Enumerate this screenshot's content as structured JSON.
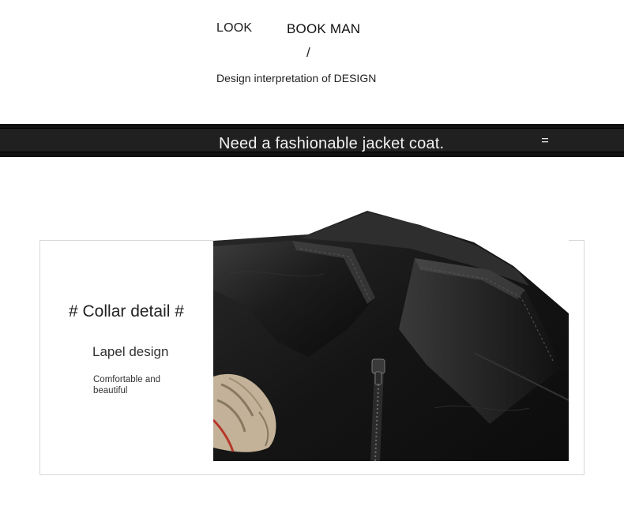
{
  "header": {
    "look_label": "LOOK",
    "brand_name": "BOOK MAN",
    "divider": "/",
    "subtitle": "Design interpretation of DESIGN"
  },
  "banner": {
    "text": "Need a fashionable jacket coat.",
    "icon": "menu-icon"
  },
  "detail_card": {
    "title": "# Collar detail #",
    "subtitle": "Lapel design",
    "description": "Comfortable and beautiful"
  },
  "product_image": {
    "subject": "black leather jacket collar with zipper and embroidered patch",
    "colors": {
      "leather": "#141414",
      "highlight": "#4a4a4a",
      "patch": "#cdbba0",
      "patch_accent": "#c0392b"
    }
  }
}
